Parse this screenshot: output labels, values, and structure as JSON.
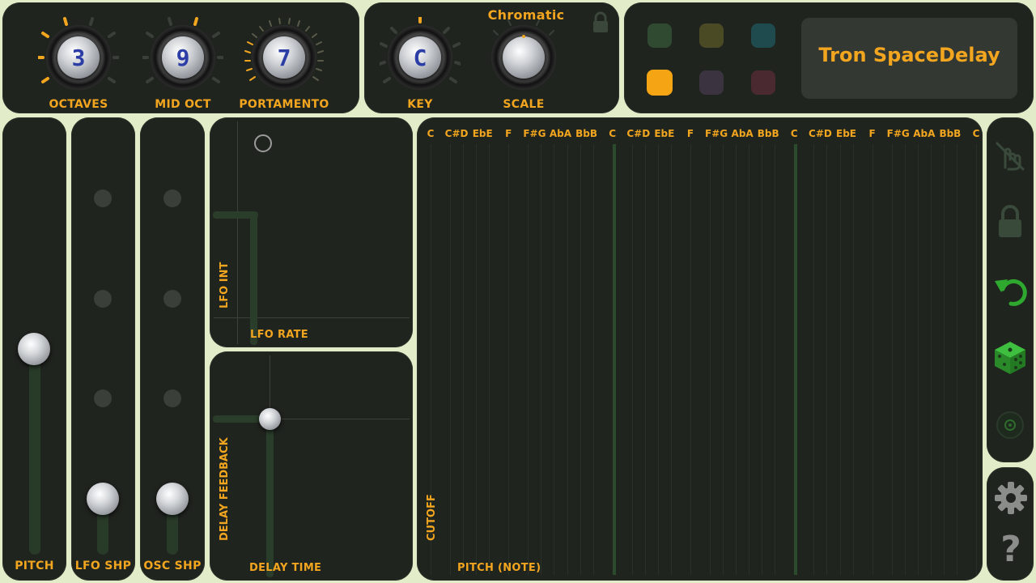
{
  "colors": {
    "background": "#e3ecc8",
    "panel": "#20241f",
    "accent": "#f2a51f",
    "active_green": "#2ea82e",
    "knob_value": "#2c3ea6"
  },
  "knobs": {
    "octaves": {
      "value": "3",
      "label": "OCTAVES"
    },
    "mid_oct": {
      "value": "9",
      "label": "MID OCT"
    },
    "portamento": {
      "value": "7",
      "label": "PORTAMENTO"
    },
    "key": {
      "value": "C",
      "label": "KEY"
    },
    "scale": {
      "value": "",
      "label": "SCALE"
    }
  },
  "scale_name": "Chromatic",
  "preset": {
    "name": "Tron SpaceDelay",
    "swatches": [
      {
        "color": "#2f4a31",
        "selected": false
      },
      {
        "color": "#4a4a25",
        "selected": false
      },
      {
        "color": "#1f4a4e",
        "selected": false
      },
      {
        "color": "#f5a414",
        "selected": true
      },
      {
        "color": "#3b3440",
        "selected": false
      },
      {
        "color": "#4a2a30",
        "selected": false
      }
    ]
  },
  "sliders": {
    "pitch": {
      "label": "PITCH",
      "level": 0.27
    },
    "lfo_shp": {
      "label": "LFO SHP",
      "level": 0.0
    },
    "osc_shp": {
      "label": "OSC SHP",
      "level": 0.0
    }
  },
  "pads": {
    "lfo": {
      "x_label": "LFO RATE",
      "y_label": "LFO INT"
    },
    "delay": {
      "x_label": "DELAY TIME",
      "y_label": "DELAY FEEDBACK"
    }
  },
  "keyboard": {
    "notes": [
      "C",
      "C#D",
      "EbE",
      "F",
      "F#G",
      "AbA",
      "BbB",
      "C",
      "C#D",
      "EbE",
      "F",
      "F#G",
      "AbA",
      "BbB",
      "C",
      "C#D",
      "EbE",
      "F",
      "F#G",
      "AbA",
      "BbB",
      "C"
    ],
    "x_label": "PITCH (NOTE)",
    "y_label": "CUTOFF"
  },
  "side_icons": [
    "no-touch-icon",
    "lock-icon",
    "undo-icon",
    "dice-icon",
    "record-icon"
  ],
  "bottom_icons": [
    "gear-icon",
    "help-icon"
  ],
  "help_glyph": "?"
}
